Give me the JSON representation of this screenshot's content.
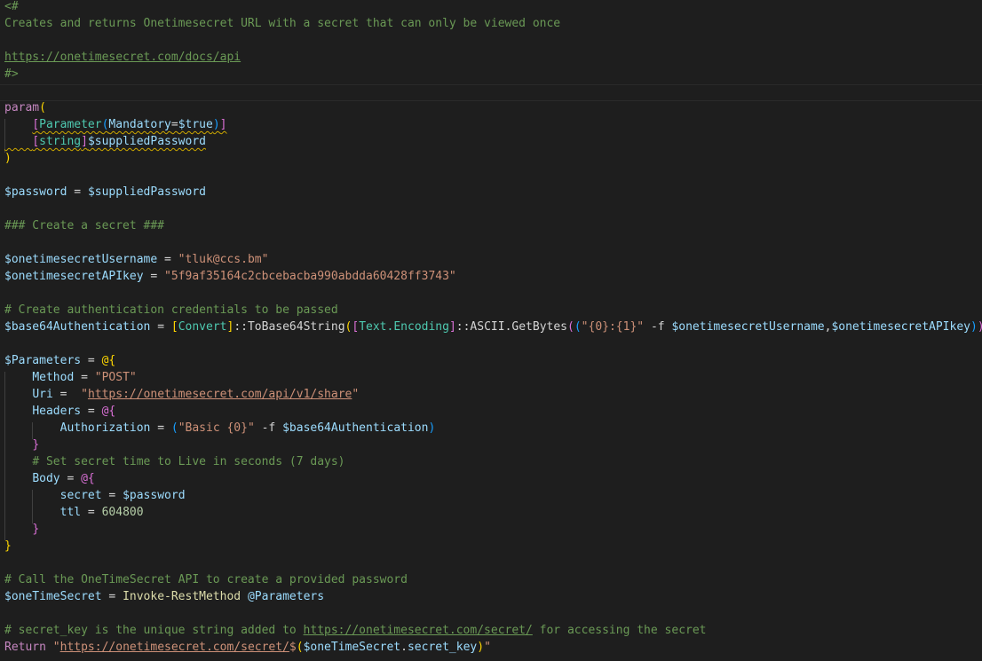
{
  "file": {
    "lines": [
      [
        [
          "cm",
          "<#"
        ]
      ],
      [
        [
          "cm",
          "Creates and returns Onetimesecret URL with a secret that can only be viewed once"
        ]
      ],
      [],
      [
        [
          "cm ul",
          "https://onetimesecret.com/docs/api"
        ]
      ],
      [
        [
          "cm",
          "#>"
        ]
      ],
      [],
      [
        [
          "kw",
          "param"
        ],
        [
          "b1",
          "("
        ]
      ],
      [
        [
          "op",
          "    "
        ],
        [
          "b2 squig",
          "["
        ],
        [
          "typ squig",
          "Parameter"
        ],
        [
          "b3 squig",
          "("
        ],
        [
          "var squig",
          "Mandatory"
        ],
        [
          "op squig",
          "="
        ],
        [
          "var squig",
          "$true"
        ],
        [
          "b3 squig",
          ")"
        ],
        [
          "b2 squig",
          "]"
        ]
      ],
      [
        [
          "op squig",
          "    "
        ],
        [
          "b2 squig",
          "["
        ],
        [
          "typ squig",
          "string"
        ],
        [
          "b2 squig",
          "]"
        ],
        [
          "var squig",
          "$suppliedPassword"
        ]
      ],
      [
        [
          "b1",
          ")"
        ]
      ],
      [],
      [
        [
          "var",
          "$password"
        ],
        [
          "op",
          " = "
        ],
        [
          "var",
          "$suppliedPassword"
        ]
      ],
      [],
      [
        [
          "cm",
          "### Create a secret ###"
        ]
      ],
      [],
      [
        [
          "var",
          "$onetimesecretUsername"
        ],
        [
          "op",
          " = "
        ],
        [
          "str",
          "\"tluk@ccs.bm\""
        ]
      ],
      [
        [
          "var",
          "$onetimesecretAPIkey"
        ],
        [
          "op",
          " = "
        ],
        [
          "str",
          "\"5f9af35164c2cbcebacba990abdda60428ff3743\""
        ]
      ],
      [],
      [
        [
          "cm",
          "# Create authentication credentials to be passed"
        ]
      ],
      [
        [
          "var",
          "$base64Authentication"
        ],
        [
          "op",
          " = "
        ],
        [
          "b1",
          "["
        ],
        [
          "typ",
          "Convert"
        ],
        [
          "b1",
          "]"
        ],
        [
          "op",
          "::ToBase64String"
        ],
        [
          "b1",
          "("
        ],
        [
          "b2",
          "["
        ],
        [
          "typ",
          "Text.Encoding"
        ],
        [
          "b2",
          "]"
        ],
        [
          "op",
          "::ASCII.GetBytes"
        ],
        [
          "b2",
          "("
        ],
        [
          "b3",
          "("
        ],
        [
          "str",
          "\"{0}:{1}\""
        ],
        [
          "op",
          " -f "
        ],
        [
          "var",
          "$onetimesecretUsername"
        ],
        [
          "op",
          ","
        ],
        [
          "var",
          "$onetimesecretAPIkey"
        ],
        [
          "b3",
          ")"
        ],
        [
          "b2",
          ")"
        ],
        [
          "b1",
          ")"
        ]
      ],
      [],
      [
        [
          "var",
          "$Parameters"
        ],
        [
          "op",
          " = "
        ],
        [
          "b1",
          "@{"
        ]
      ],
      [
        [
          "op",
          "    "
        ],
        [
          "var",
          "Method"
        ],
        [
          "op",
          " = "
        ],
        [
          "str",
          "\"POST\""
        ]
      ],
      [
        [
          "op",
          "    "
        ],
        [
          "var",
          "Uri"
        ],
        [
          "op",
          " =  "
        ],
        [
          "str",
          "\""
        ],
        [
          "str ul",
          "https://onetimesecret.com/api/v1/share"
        ],
        [
          "str",
          "\""
        ]
      ],
      [
        [
          "op",
          "    "
        ],
        [
          "var",
          "Headers"
        ],
        [
          "op",
          " = "
        ],
        [
          "b2",
          "@{"
        ]
      ],
      [
        [
          "op",
          "        "
        ],
        [
          "var",
          "Authorization"
        ],
        [
          "op",
          " = "
        ],
        [
          "b3",
          "("
        ],
        [
          "str",
          "\"Basic {0}\""
        ],
        [
          "op",
          " -f "
        ],
        [
          "var",
          "$base64Authentication"
        ],
        [
          "b3",
          ")"
        ]
      ],
      [
        [
          "op",
          "    "
        ],
        [
          "b2",
          "}"
        ]
      ],
      [
        [
          "op",
          "    "
        ],
        [
          "cm",
          "# Set secret time to Live in seconds (7 days)"
        ]
      ],
      [
        [
          "op",
          "    "
        ],
        [
          "var",
          "Body"
        ],
        [
          "op",
          " = "
        ],
        [
          "b2",
          "@{"
        ]
      ],
      [
        [
          "op",
          "        "
        ],
        [
          "var",
          "secret"
        ],
        [
          "op",
          " = "
        ],
        [
          "var",
          "$password"
        ]
      ],
      [
        [
          "op",
          "        "
        ],
        [
          "var",
          "ttl"
        ],
        [
          "op",
          " = "
        ],
        [
          "num",
          "604800"
        ]
      ],
      [
        [
          "op",
          "    "
        ],
        [
          "b2",
          "}"
        ]
      ],
      [
        [
          "b1",
          "}"
        ]
      ],
      [],
      [
        [
          "cm",
          "# Call the OneTimeSecret API to create a provided password"
        ]
      ],
      [
        [
          "var",
          "$oneTimeSecret"
        ],
        [
          "op",
          " = "
        ],
        [
          "fn",
          "Invoke-RestMethod"
        ],
        [
          "op",
          " "
        ],
        [
          "var",
          "@Parameters"
        ]
      ],
      [],
      [
        [
          "cm",
          "# secret_key is the unique string added to "
        ],
        [
          "cm ul",
          "https://onetimesecret.com/secret/"
        ],
        [
          "cm",
          " for accessing the secret"
        ]
      ],
      [
        [
          "kw",
          "Return"
        ],
        [
          "op",
          " "
        ],
        [
          "str",
          "\""
        ],
        [
          "str ul",
          "https://onetimesecret.com/secret/"
        ],
        [
          "str",
          "$"
        ],
        [
          "b1",
          "("
        ],
        [
          "var",
          "$oneTimeSecret"
        ],
        [
          "op",
          "."
        ],
        [
          "var",
          "secret_key"
        ],
        [
          "b1",
          ")"
        ],
        [
          "str",
          "\""
        ]
      ]
    ]
  },
  "colors": {
    "background": "#1e1e1e",
    "comment": "#6a9955",
    "keyword": "#c586c0",
    "variable": "#9cdcfe",
    "string": "#ce9178",
    "type": "#4ec9b0",
    "function": "#dcdcaa",
    "number": "#b5cea8",
    "bracket_1": "#ffd700",
    "bracket_2": "#da70d6",
    "bracket_3": "#179fff"
  }
}
